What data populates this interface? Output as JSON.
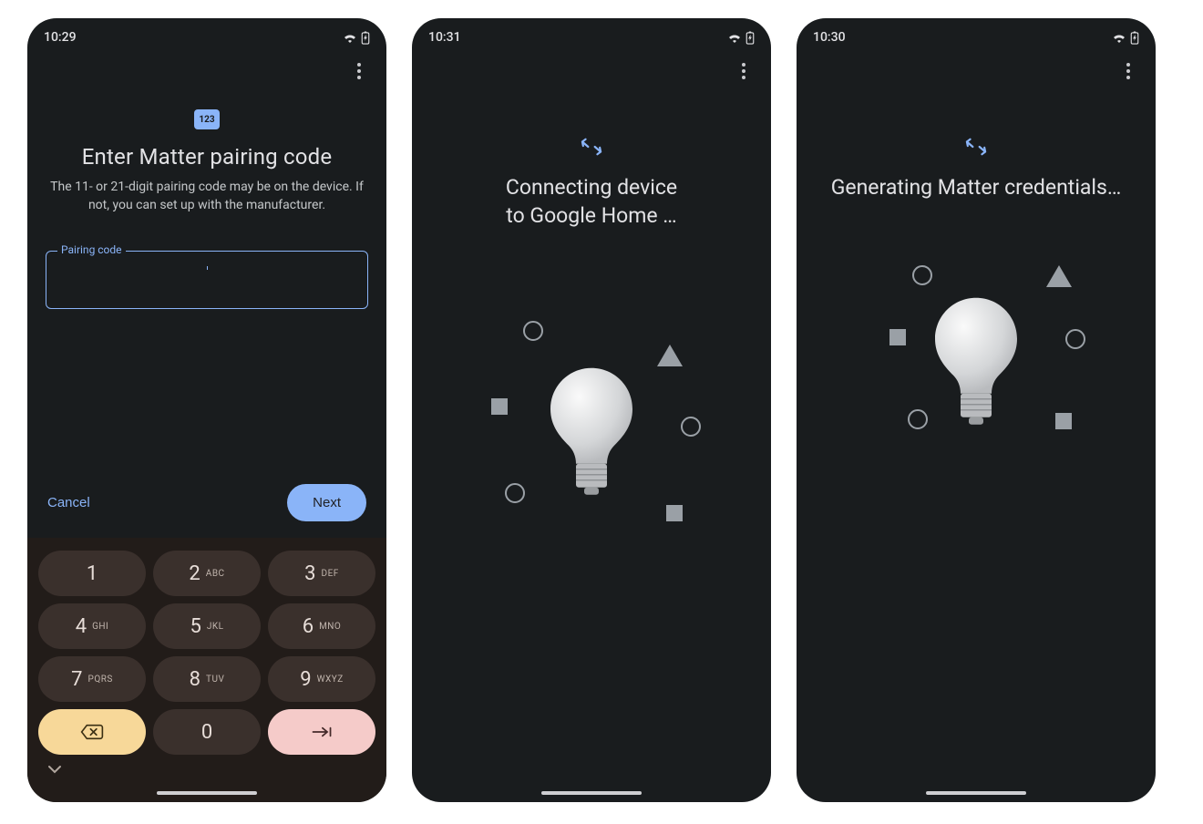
{
  "screens": [
    {
      "statusbar": {
        "time": "10:29"
      },
      "badge_text": "123",
      "title": "Enter Matter pairing code",
      "subtitle": "The 11- or 21-digit pairing code may be on the device. If not, you can set up with the manufacturer.",
      "input": {
        "label": "Pairing code",
        "value": ""
      },
      "actions": {
        "cancel": "Cancel",
        "next": "Next"
      },
      "keypad": [
        {
          "digit": "1",
          "letters": ""
        },
        {
          "digit": "2",
          "letters": "ABC"
        },
        {
          "digit": "3",
          "letters": "DEF"
        },
        {
          "digit": "4",
          "letters": "GHI"
        },
        {
          "digit": "5",
          "letters": "JKL"
        },
        {
          "digit": "6",
          "letters": "MNO"
        },
        {
          "digit": "7",
          "letters": "PQRS"
        },
        {
          "digit": "8",
          "letters": "TUV"
        },
        {
          "digit": "9",
          "letters": "WXYZ"
        },
        {
          "digit": "0",
          "letters": ""
        }
      ]
    },
    {
      "statusbar": {
        "time": "10:31"
      },
      "title_line1": "Connecting device",
      "title_line2": "to Google Home …"
    },
    {
      "statusbar": {
        "time": "10:30"
      },
      "title": "Generating Matter credentials…"
    }
  ],
  "colors": {
    "accent": "#8ab4f8",
    "bg": "#191c1e",
    "key_bg": "#3a302c"
  }
}
